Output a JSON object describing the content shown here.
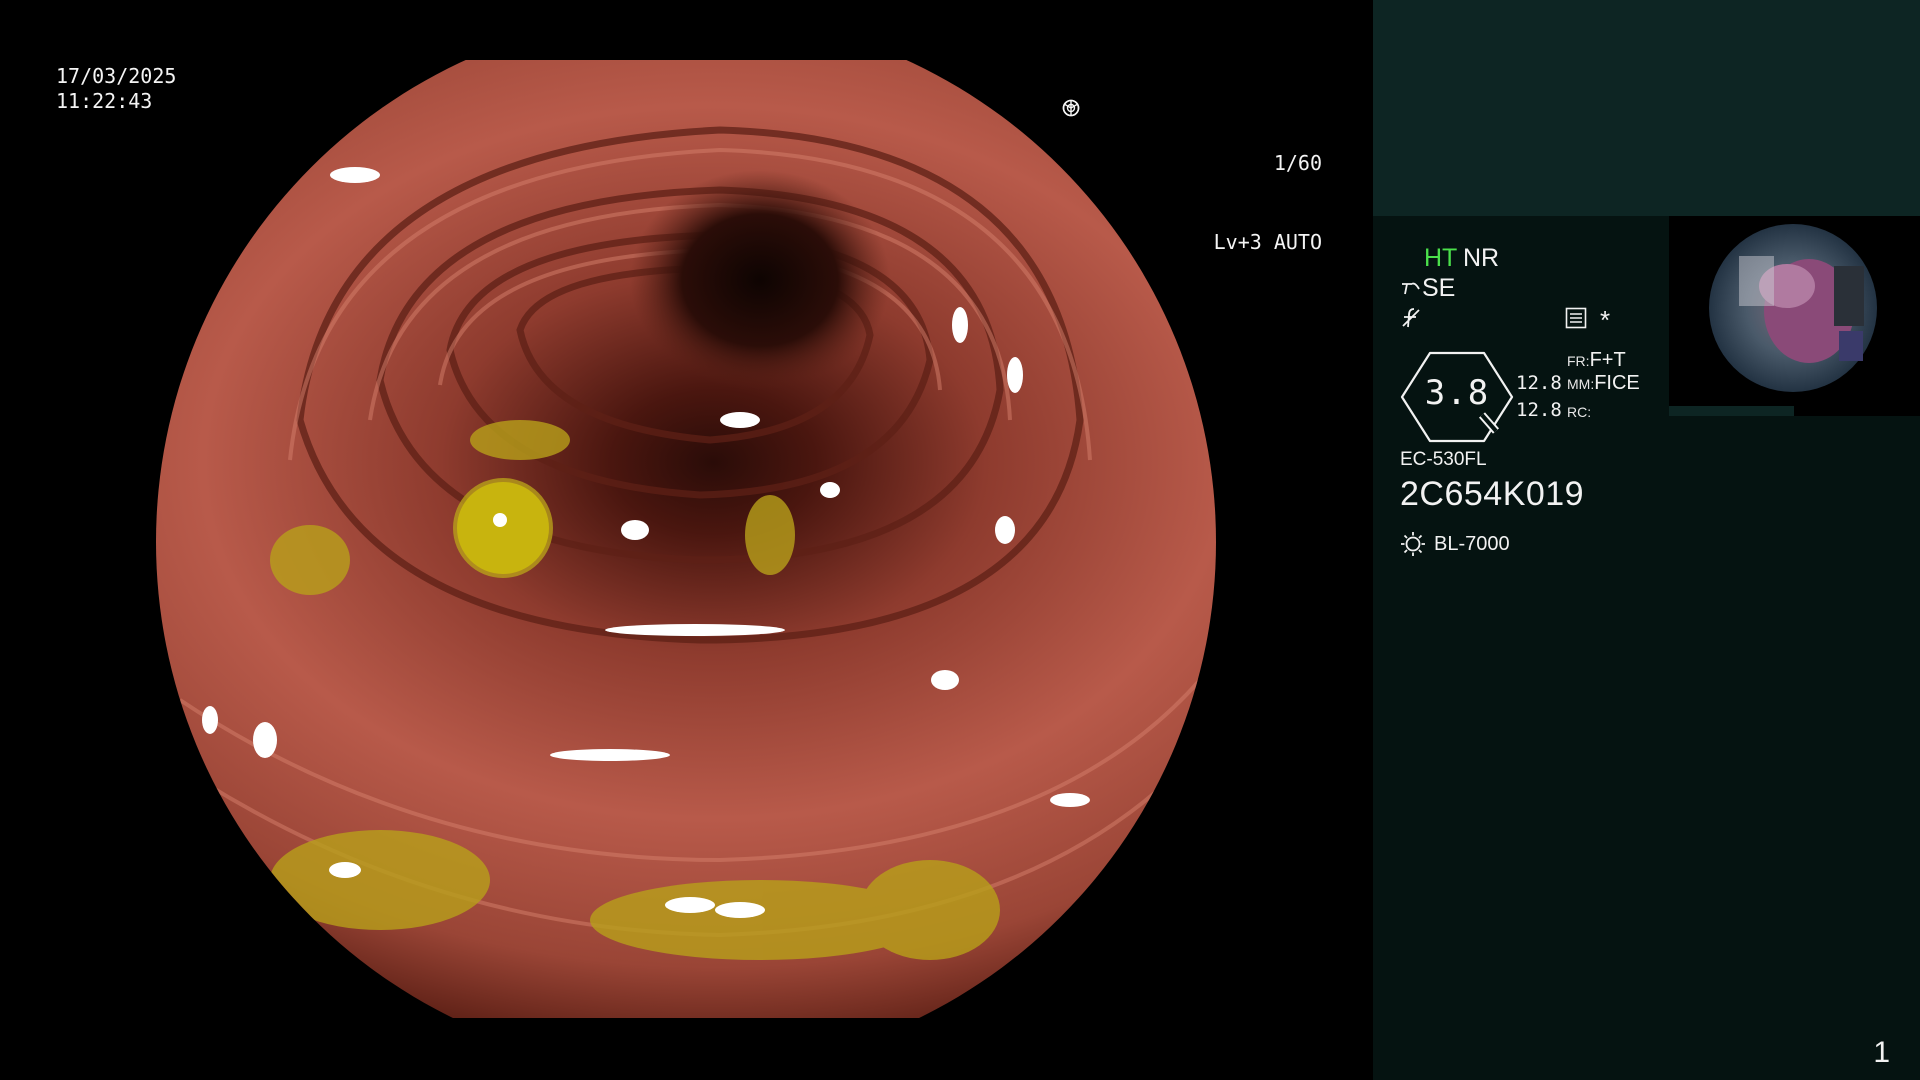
{
  "osd": {
    "date": "17/03/2025",
    "time": "11:22:43",
    "shutter": "1/60",
    "iris": "Lv+3 AUTO"
  },
  "panel": {
    "mode_ht": "HT",
    "mode_nr": "NR",
    "se_label": "SE",
    "zoom_value": "3.8",
    "zoom_a": "12.8",
    "zoom_b": "12.8",
    "fr_label": "FR:",
    "fr_value": "F+T",
    "mm_label": "MM:",
    "mm_value": "FICE",
    "rc_label": "RC:",
    "scope_model": "EC-530FL",
    "scope_serial": "2C654K019",
    "light_source": "BL-7000",
    "asterisk": "*",
    "page_number": "1"
  },
  "colors": {
    "panel_background": "#051311",
    "panel_top_band": "#0d2523",
    "ht_green": "#4be04b"
  },
  "icons": [
    "shutter-icon",
    "iris-icon",
    "se-icon",
    "f-icon",
    "menu-icon",
    "zoom-badge-icon",
    "light-source-icon"
  ]
}
